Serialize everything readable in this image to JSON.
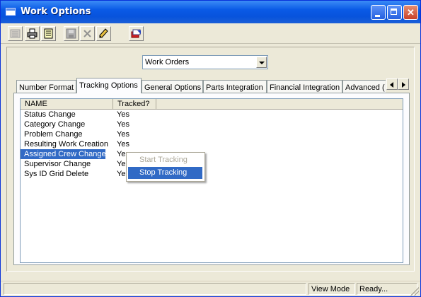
{
  "window": {
    "title": "Work Options"
  },
  "toolbar": {
    "icons": [
      "list-icon",
      "print-icon",
      "notes-icon",
      "save-icon",
      "delete-icon",
      "edit-icon",
      "exit-icon"
    ]
  },
  "module_select": {
    "value": "Work Orders"
  },
  "tabs": [
    {
      "label": "Number Format",
      "active": false
    },
    {
      "label": "Tracking Options",
      "active": true
    },
    {
      "label": "General Options",
      "active": false
    },
    {
      "label": "Parts Integration",
      "active": false
    },
    {
      "label": "Financial Integration",
      "active": false
    },
    {
      "label": "Advanced (",
      "active": false
    }
  ],
  "grid": {
    "columns": [
      "NAME",
      "Tracked?"
    ],
    "rows": [
      {
        "name": "Status Change",
        "tracked": "Yes",
        "selected": false
      },
      {
        "name": "Category Change",
        "tracked": "Yes",
        "selected": false
      },
      {
        "name": "Problem Change",
        "tracked": "Yes",
        "selected": false
      },
      {
        "name": "Resulting Work Creation",
        "tracked": "Yes",
        "selected": false
      },
      {
        "name": "Assigned Crew Change",
        "tracked": "Yes",
        "selected": true
      },
      {
        "name": "Supervisor Change",
        "tracked": "Yes",
        "selected": false
      },
      {
        "name": "Sys ID Grid Delete",
        "tracked": "Yes",
        "selected": false
      }
    ]
  },
  "context_menu": {
    "items": [
      {
        "label": "Start Tracking",
        "enabled": false
      },
      {
        "label": "Stop Tracking",
        "enabled": true,
        "highlighted": true
      }
    ]
  },
  "statusbar": {
    "mode": "View Mode",
    "status": "Ready..."
  },
  "colors": {
    "title_bar": "#0a5ae6",
    "selection": "#316ac5",
    "face": "#ece9d8"
  }
}
